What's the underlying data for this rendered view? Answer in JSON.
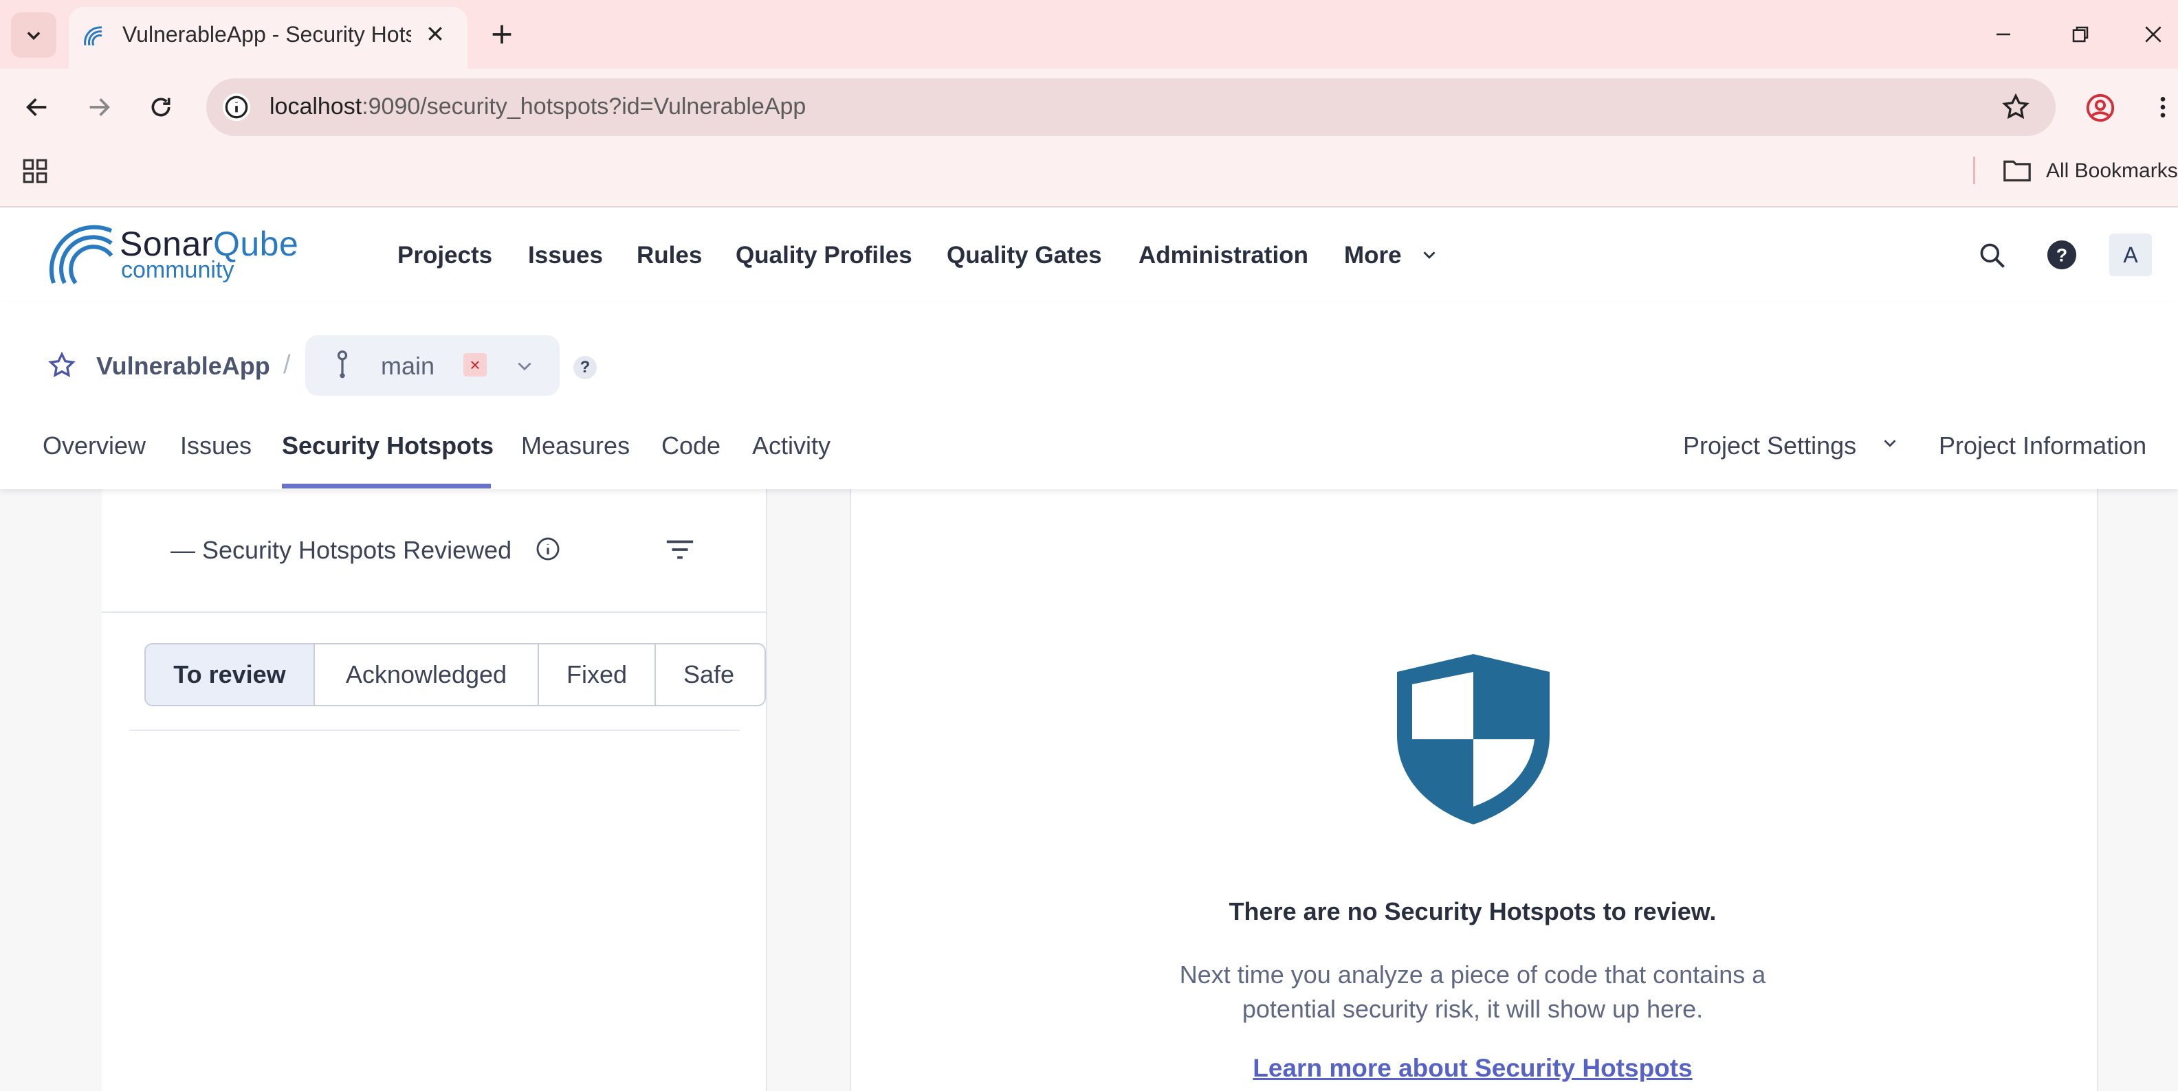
{
  "browser": {
    "tab_title": "VulnerableApp - Security Hotspots",
    "new_tab_icon": "plus-icon",
    "url_host": "localhost",
    "url_rest": ":9090/security_hotspots?id=VulnerableApp",
    "bookmarks_label": "All Bookmarks"
  },
  "header": {
    "logo_sonar": "Sonar",
    "logo_qube": "Qube",
    "logo_community": "community",
    "nav": [
      "Projects",
      "Issues",
      "Rules",
      "Quality Profiles",
      "Quality Gates",
      "Administration",
      "More"
    ],
    "avatar_letter": "A"
  },
  "project": {
    "name": "VulnerableApp",
    "separator": "/",
    "branch": "main",
    "branch_remove": "×",
    "help": "?",
    "tabs": [
      "Overview",
      "Issues",
      "Security Hotspots",
      "Measures",
      "Code",
      "Activity"
    ],
    "active_tab": "Security Hotspots",
    "settings_label": "Project Settings",
    "info_label": "Project Information"
  },
  "hotspots": {
    "reviewed_label": "— Security Hotspots Reviewed",
    "status_filters": [
      "To review",
      "Acknowledged",
      "Fixed",
      "Safe"
    ],
    "active_filter": "To review"
  },
  "empty_state": {
    "title": "There are no Security Hotspots to review.",
    "description_line1": "Next time you analyze a piece of code that contains a",
    "description_line2": "potential security risk, it will show up here.",
    "link": "Learn more about Security Hotspots"
  },
  "colors": {
    "accent": "#6872c8",
    "shield": "#236a97",
    "chrome_bg": "#fde3e3"
  }
}
